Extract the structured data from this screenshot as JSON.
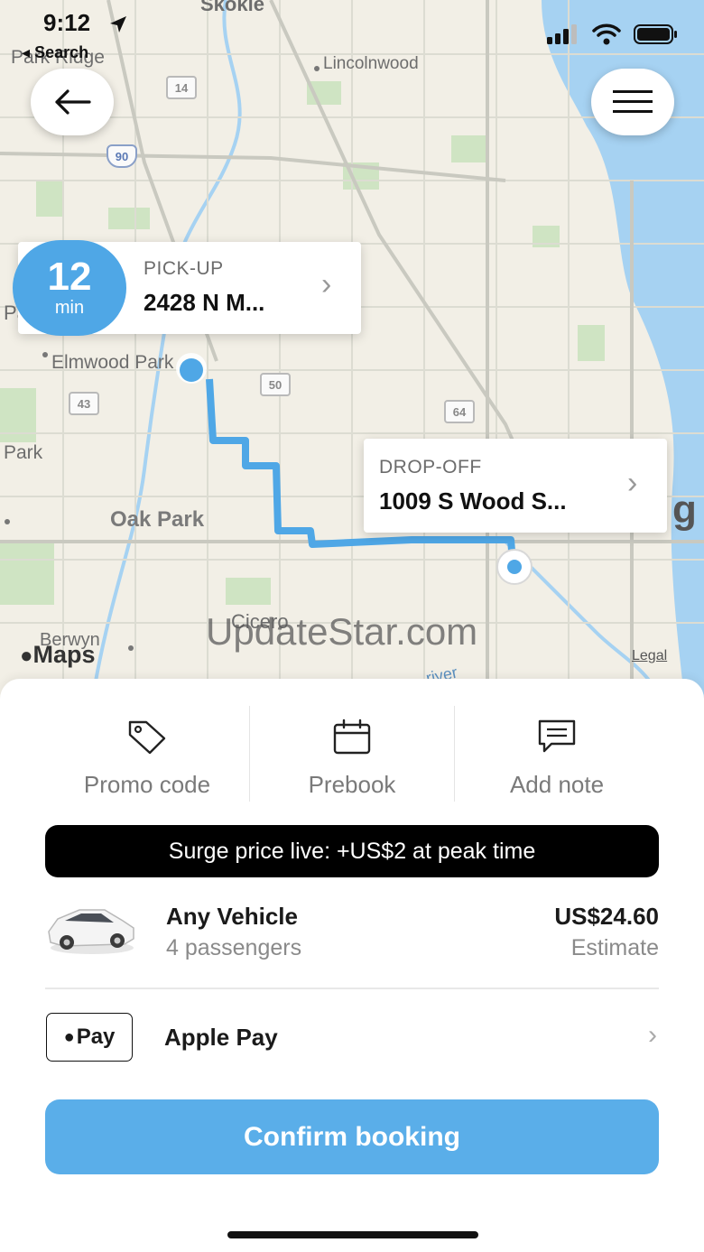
{
  "status_bar": {
    "time": "9:12",
    "back_app": "Search"
  },
  "map": {
    "places": {
      "skokie": "Skokie",
      "park_ridge": "Park Ridge",
      "lincolnwood": "Lincolnwood",
      "elmwood_park": "Elmwood Park",
      "park": "Park",
      "pa": "Pa",
      "oak_park": "Oak Park",
      "cicero": "Cicero",
      "berwyn": "Berwyn",
      "river": "river",
      "chicago_fragment": "g"
    },
    "highways": {
      "h14": "14",
      "h90": "90",
      "h50": "50",
      "h43": "43",
      "h64": "64"
    },
    "provider": "Maps",
    "legal": "Legal",
    "watermark": "UpdateStar.com"
  },
  "eta": {
    "value": "12",
    "unit": "min"
  },
  "pickup": {
    "label": "PICK-UP",
    "address": "2428 N M..."
  },
  "dropoff": {
    "label": "DROP-OFF",
    "address": "1009 S Wood S..."
  },
  "options": {
    "promo": "Promo code",
    "prebook": "Prebook",
    "note": "Add note"
  },
  "surge": {
    "text": "Surge price live: +US$2 at peak time"
  },
  "vehicle": {
    "name": "Any Vehicle",
    "passengers": "4 passengers",
    "price": "US$24.60",
    "price_note": "Estimate"
  },
  "payment": {
    "badge": "Pay",
    "method": "Apple Pay"
  },
  "confirm_label": "Confirm booking",
  "colors": {
    "accent": "#5aaee9",
    "route": "#4fa7e6",
    "surge_bg": "#000000",
    "water": "#a6d2f2"
  }
}
